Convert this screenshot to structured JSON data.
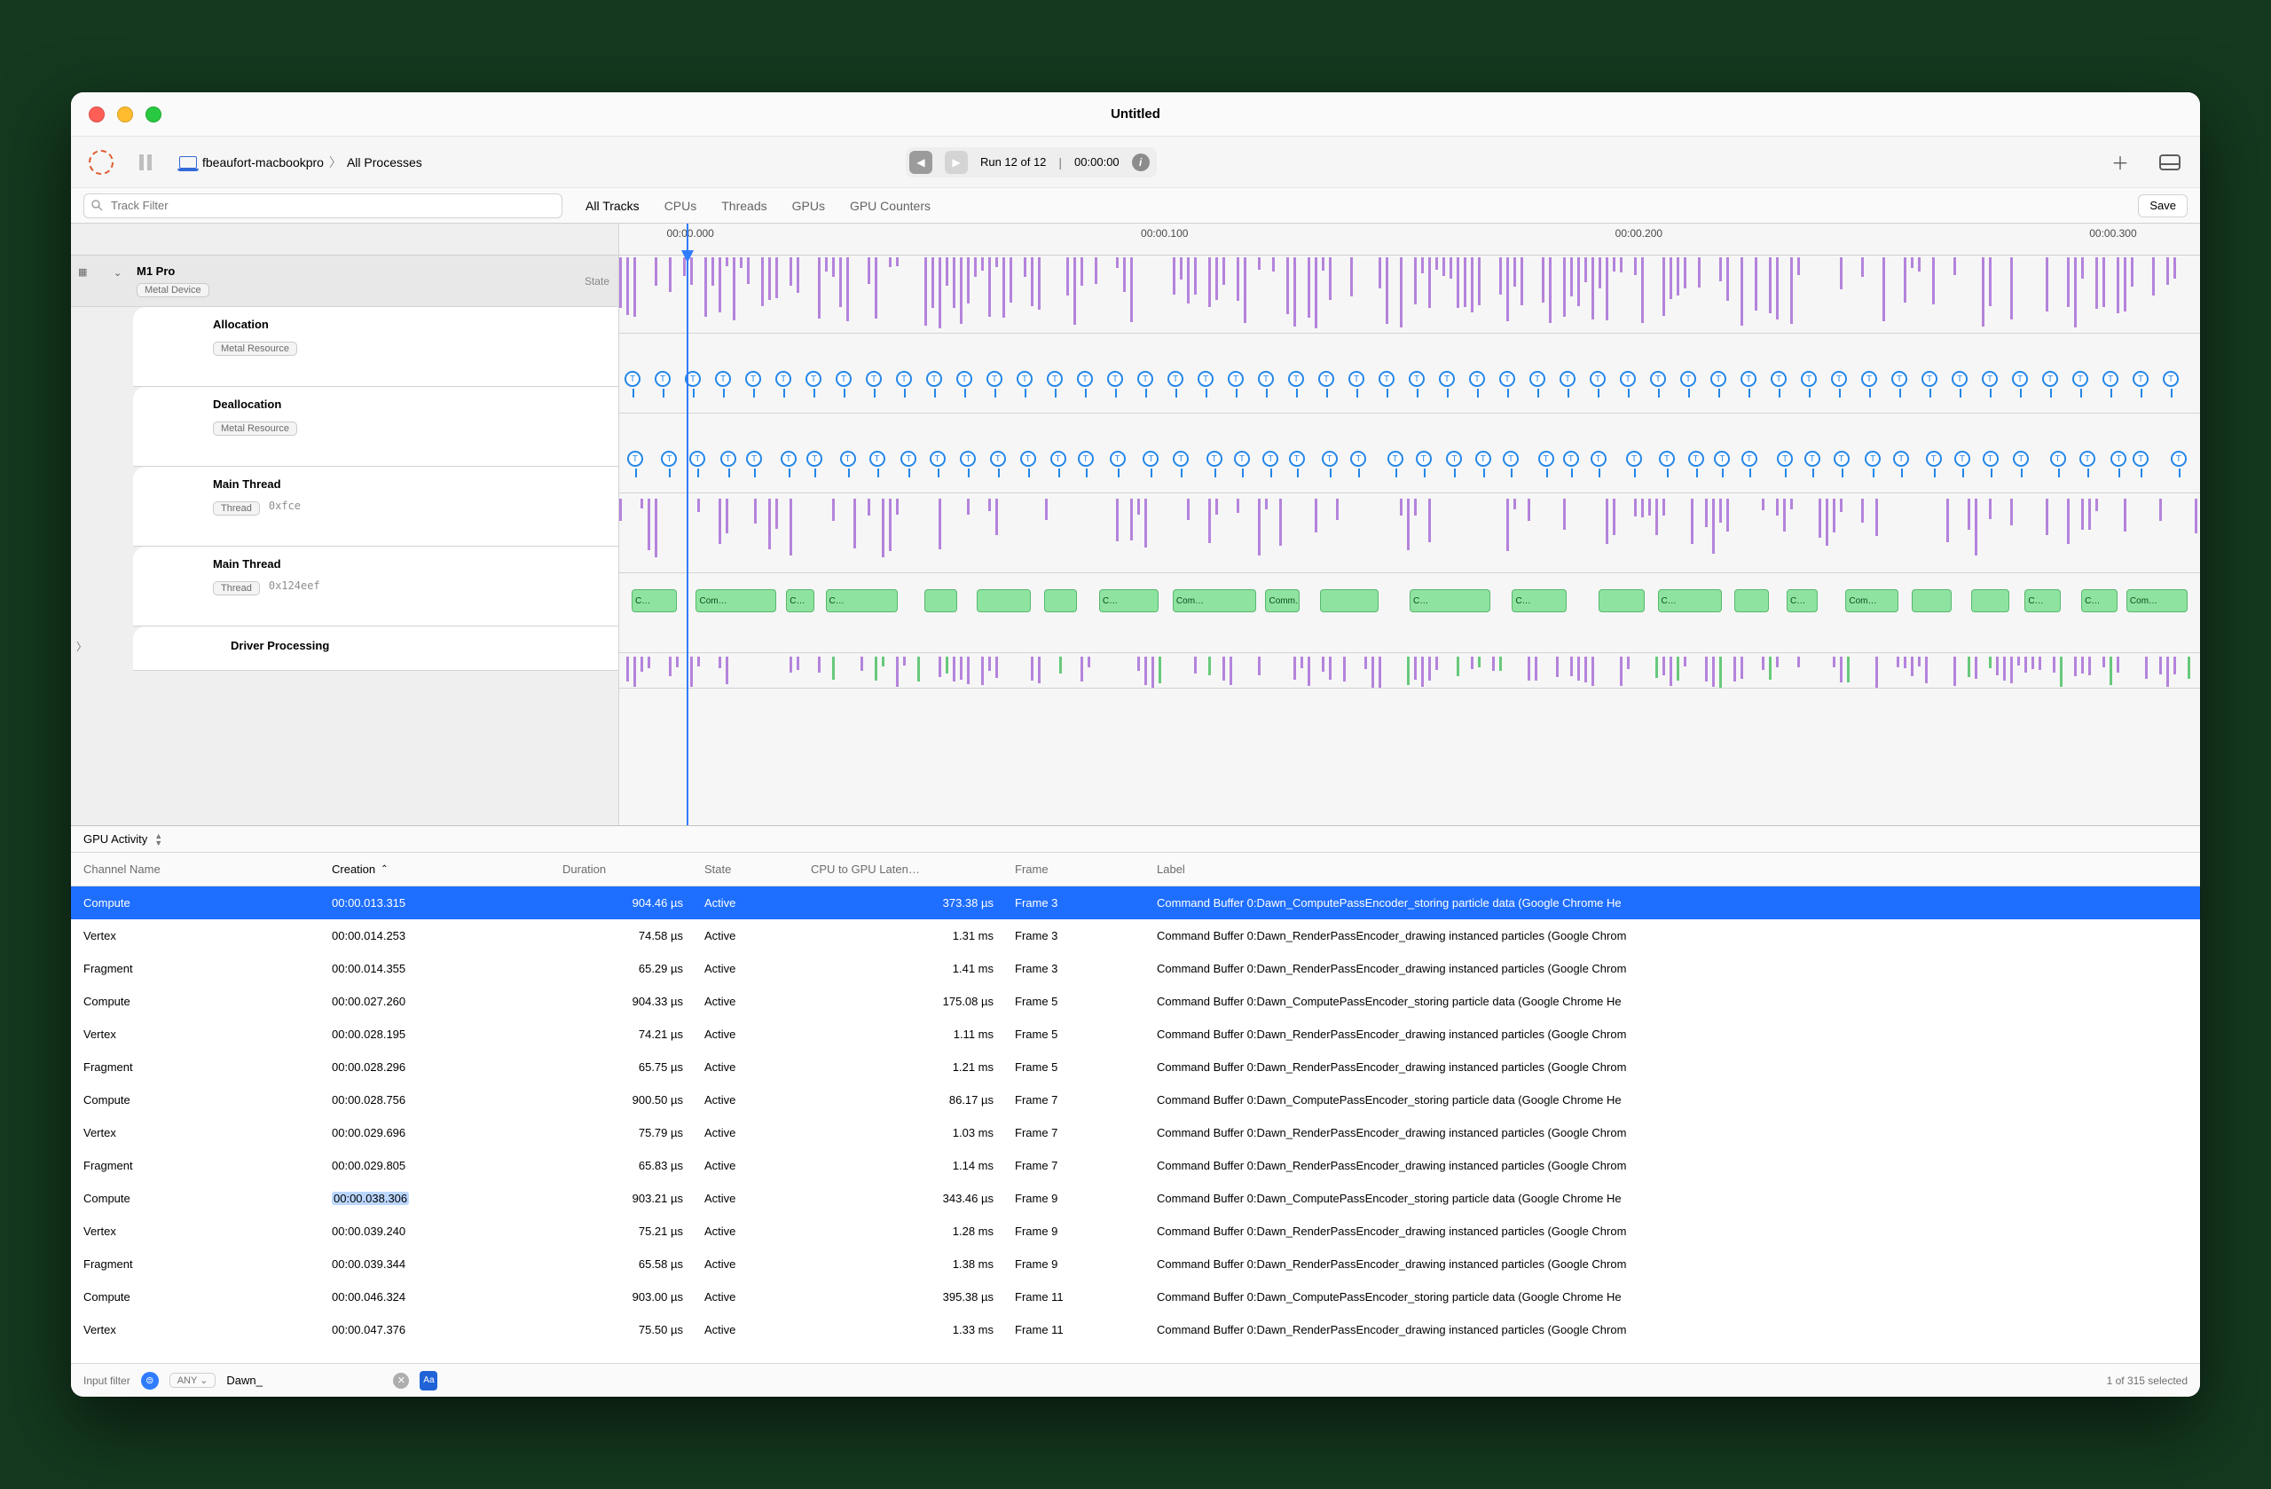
{
  "window": {
    "title": "Untitled"
  },
  "toolbar": {
    "breadcrumb_host": "fbeaufort-macbookpro",
    "breadcrumb_scope": "All Processes",
    "run_label": "Run 12 of 12",
    "run_time": "00:00:00",
    "save": "Save"
  },
  "filters": {
    "track_placeholder": "Track Filter",
    "tabs": [
      "All Tracks",
      "CPUs",
      "Threads",
      "GPUs",
      "GPU Counters"
    ],
    "active": 0
  },
  "ruler": {
    "ticks": [
      {
        "pct": 3,
        "label": "00:00.000"
      },
      {
        "pct": 33,
        "label": "00:00.100"
      },
      {
        "pct": 63,
        "label": "00:00.200"
      },
      {
        "pct": 93,
        "label": "00:00.300"
      }
    ]
  },
  "tracks": {
    "root": {
      "name": "M1 Pro",
      "tag": "Metal Device",
      "state": "State"
    },
    "rows": [
      {
        "name": "Allocation",
        "tag": "Metal Resource"
      },
      {
        "name": "Deallocation",
        "tag": "Metal Resource"
      },
      {
        "name": "Main Thread",
        "tag": "Thread",
        "suffix": "0xfce"
      },
      {
        "name": "Main Thread",
        "tag": "Thread",
        "suffix": "0x124eef"
      },
      {
        "name": "Driver Processing"
      }
    ]
  },
  "bottom": {
    "tab": "GPU Activity",
    "columns": [
      "Channel Name",
      "Creation",
      "Duration",
      "State",
      "CPU to GPU Laten…",
      "Frame",
      "Label"
    ],
    "sort_column": "Creation",
    "rows": [
      {
        "sel": true,
        "chan": "Compute",
        "cre": "00:00.013.315",
        "dur": "904.46 µs",
        "sta": "Active",
        "lat": "373.38 µs",
        "frm": "Frame 3",
        "lab": "Command Buffer 0:Dawn_ComputePassEncoder_storing particle data   (Google Chrome He"
      },
      {
        "chan": "Vertex",
        "cre": "00:00.014.253",
        "dur": "74.58 µs",
        "sta": "Active",
        "lat": "1.31 ms",
        "frm": "Frame 3",
        "lab": "Command Buffer 0:Dawn_RenderPassEncoder_drawing instanced particles   (Google Chrom"
      },
      {
        "chan": "Fragment",
        "cre": "00:00.014.355",
        "dur": "65.29 µs",
        "sta": "Active",
        "lat": "1.41 ms",
        "frm": "Frame 3",
        "lab": "Command Buffer 0:Dawn_RenderPassEncoder_drawing instanced particles   (Google Chrom"
      },
      {
        "chan": "Compute",
        "cre": "00:00.027.260",
        "dur": "904.33 µs",
        "sta": "Active",
        "lat": "175.08 µs",
        "frm": "Frame 5",
        "lab": "Command Buffer 0:Dawn_ComputePassEncoder_storing particle data   (Google Chrome He"
      },
      {
        "chan": "Vertex",
        "cre": "00:00.028.195",
        "dur": "74.21 µs",
        "sta": "Active",
        "lat": "1.11 ms",
        "frm": "Frame 5",
        "lab": "Command Buffer 0:Dawn_RenderPassEncoder_drawing instanced particles   (Google Chrom"
      },
      {
        "chan": "Fragment",
        "cre": "00:00.028.296",
        "dur": "65.75 µs",
        "sta": "Active",
        "lat": "1.21 ms",
        "frm": "Frame 5",
        "lab": "Command Buffer 0:Dawn_RenderPassEncoder_drawing instanced particles   (Google Chrom"
      },
      {
        "chan": "Compute",
        "cre": "00:00.028.756",
        "dur": "900.50 µs",
        "sta": "Active",
        "lat": "86.17 µs",
        "frm": "Frame 7",
        "lab": "Command Buffer 0:Dawn_ComputePassEncoder_storing particle data   (Google Chrome He"
      },
      {
        "chan": "Vertex",
        "cre": "00:00.029.696",
        "dur": "75.79 µs",
        "sta": "Active",
        "lat": "1.03 ms",
        "frm": "Frame 7",
        "lab": "Command Buffer 0:Dawn_RenderPassEncoder_drawing instanced particles   (Google Chrom"
      },
      {
        "chan": "Fragment",
        "cre": "00:00.029.805",
        "dur": "65.83 µs",
        "sta": "Active",
        "lat": "1.14 ms",
        "frm": "Frame 7",
        "lab": "Command Buffer 0:Dawn_RenderPassEncoder_drawing instanced particles   (Google Chrom"
      },
      {
        "hl": true,
        "chan": "Compute",
        "cre": "00:00.038.306",
        "dur": "903.21 µs",
        "sta": "Active",
        "lat": "343.46 µs",
        "frm": "Frame 9",
        "lab": "Command Buffer 0:Dawn_ComputePassEncoder_storing particle data   (Google Chrome He"
      },
      {
        "chan": "Vertex",
        "cre": "00:00.039.240",
        "dur": "75.21 µs",
        "sta": "Active",
        "lat": "1.28 ms",
        "frm": "Frame 9",
        "lab": "Command Buffer 0:Dawn_RenderPassEncoder_drawing instanced particles   (Google Chrom"
      },
      {
        "chan": "Fragment",
        "cre": "00:00.039.344",
        "dur": "65.58 µs",
        "sta": "Active",
        "lat": "1.38 ms",
        "frm": "Frame 9",
        "lab": "Command Buffer 0:Dawn_RenderPassEncoder_drawing instanced particles   (Google Chrom"
      },
      {
        "chan": "Compute",
        "cre": "00:00.046.324",
        "dur": "903.00 µs",
        "sta": "Active",
        "lat": "395.38 µs",
        "frm": "Frame 11",
        "lab": "Command Buffer 0:Dawn_ComputePassEncoder_storing particle data   (Google Chrome He"
      },
      {
        "chan": "Vertex",
        "cre": "00:00.047.376",
        "dur": "75.50 µs",
        "sta": "Active",
        "lat": "1.33 ms",
        "frm": "Frame 11",
        "lab": "Command Buffer 0:Dawn_RenderPassEncoder_drawing instanced particles   (Google Chrom"
      }
    ]
  },
  "footer": {
    "input_label": "Input filter",
    "any": "ANY",
    "text": "Dawn_",
    "selected": "1 of 315 selected"
  }
}
